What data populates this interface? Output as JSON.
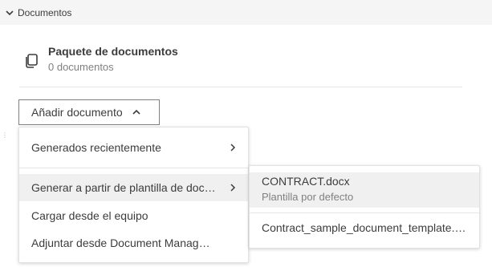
{
  "section": {
    "title": "Documentos"
  },
  "package": {
    "title": "Paquete de documentos",
    "count_text": "0 documentos"
  },
  "add_button": {
    "label": "Añadir documento"
  },
  "menu": {
    "items": [
      {
        "label": "Generados recientemente",
        "has_submenu": true
      },
      {
        "label": "Generar a partir de plantilla de documento",
        "has_submenu": true
      },
      {
        "label": "Cargar desde el equipo",
        "has_submenu": false
      },
      {
        "label": "Adjuntar desde Document Management",
        "has_submenu": false
      }
    ]
  },
  "submenu": {
    "items": [
      {
        "name": "CONTRACT.docx",
        "description": "Plantilla por defecto"
      },
      {
        "name": "Contract_sample_document_template.docx"
      }
    ]
  },
  "colors": {
    "text": "#3c3c3c",
    "muted": "#808080",
    "hover": "#f0f0f0",
    "header_bg": "#f5f5f5"
  }
}
